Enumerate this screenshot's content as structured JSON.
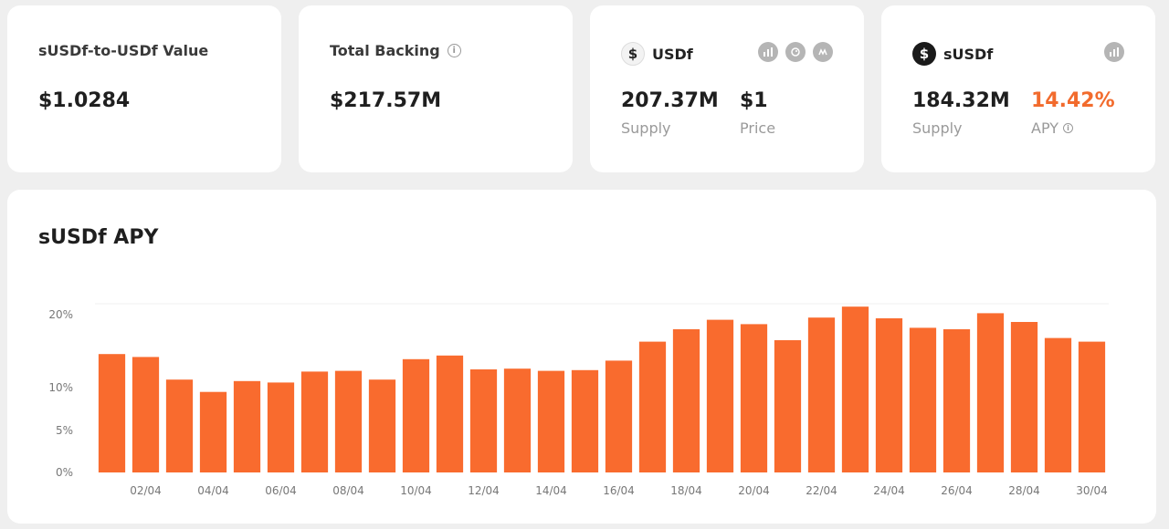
{
  "cards": {
    "value": {
      "title": "sUSDf-to-USDf Value",
      "value": "$1.0284"
    },
    "backing": {
      "title": "Total Backing",
      "value": "$217.57M"
    },
    "usdf": {
      "symbol": "$",
      "name": "USDf",
      "supply_value": "207.37M",
      "supply_label": "Supply",
      "price_value": "$1",
      "price_label": "Price",
      "ext_icons": [
        "chart-icon",
        "gecko-icon",
        "coinmarketcap-icon"
      ]
    },
    "susdf": {
      "symbol": "$",
      "name": "sUSDf",
      "supply_value": "184.32M",
      "supply_label": "Supply",
      "apy_value": "14.42%",
      "apy_label": "APY",
      "ext_icons": [
        "chart-icon"
      ]
    }
  },
  "colors": {
    "accent": "#f26b2d",
    "bar": "#f96b2e"
  },
  "chart_data": {
    "type": "bar",
    "title": "sUSDf APY",
    "xlabel": "",
    "ylabel": "",
    "y_tick_labels": [
      "0%",
      "5%",
      "10%",
      "20%"
    ],
    "y_tick_values": [
      0,
      5,
      10,
      20
    ],
    "ylim": [
      0,
      20
    ],
    "x_tick_labels": [
      "02/04",
      "04/04",
      "06/04",
      "08/04",
      "10/04",
      "12/04",
      "14/04",
      "16/04",
      "18/04",
      "20/04",
      "22/04",
      "24/04",
      "26/04",
      "28/04",
      "30/04"
    ],
    "categories": [
      "01/04",
      "02/04",
      "03/04",
      "04/04",
      "05/04",
      "06/04",
      "07/04",
      "08/04",
      "09/04",
      "10/04",
      "11/04",
      "12/04",
      "13/04",
      "14/04",
      "15/04",
      "16/04",
      "17/04",
      "18/04",
      "19/04",
      "20/04",
      "21/04",
      "22/04",
      "23/04",
      "24/04",
      "25/04",
      "26/04",
      "27/04",
      "28/04",
      "29/04",
      "30/04"
    ],
    "values": [
      14.6,
      14.2,
      11.1,
      9.5,
      10.9,
      10.7,
      12.2,
      12.3,
      11.1,
      13.9,
      14.4,
      12.5,
      12.6,
      12.3,
      12.4,
      13.7,
      16.3,
      18.0,
      19.3,
      18.7,
      16.5,
      19.6,
      21.1,
      19.5,
      18.2,
      18.0,
      20.2,
      19.0,
      16.8,
      16.3
    ]
  }
}
